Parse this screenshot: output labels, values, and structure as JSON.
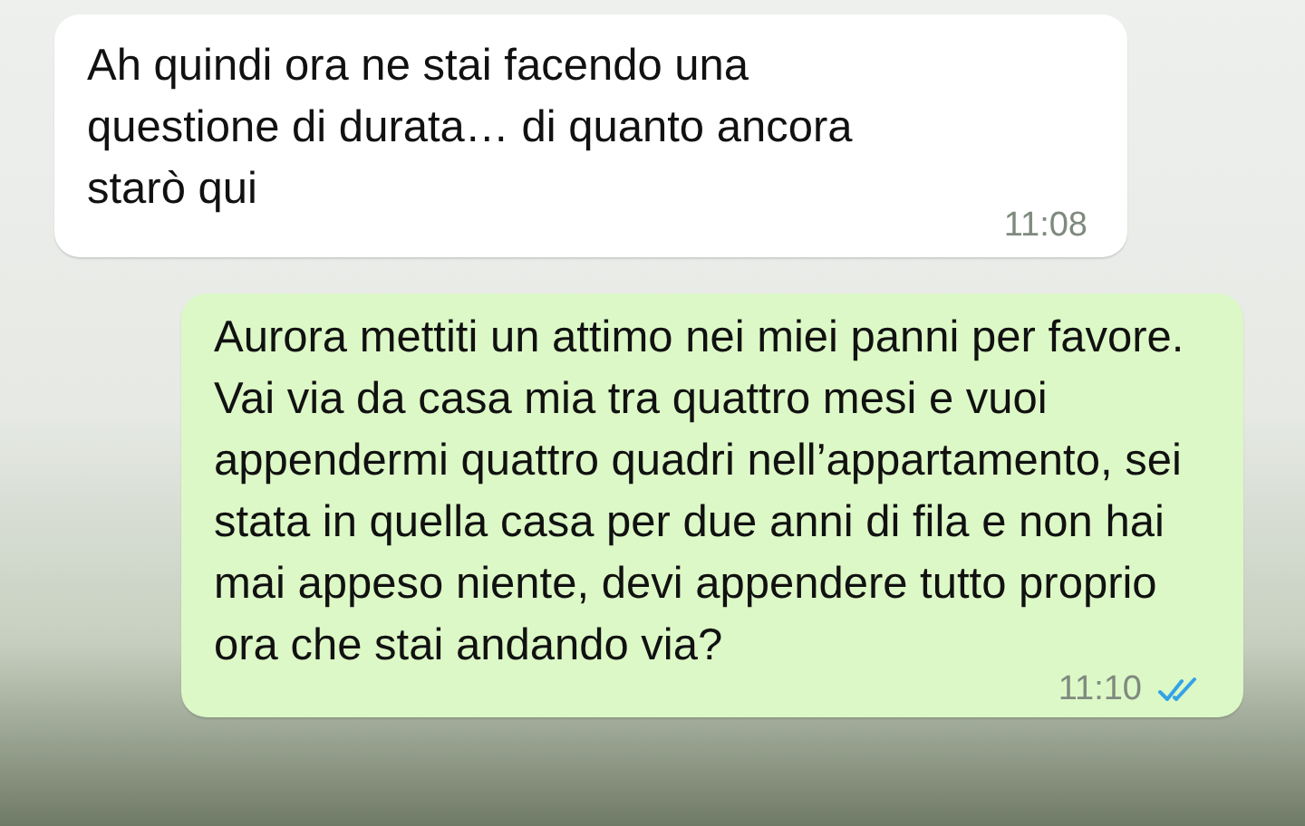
{
  "messages": [
    {
      "kind": "incoming",
      "text": "Ah quindi ora ne stai facendo una questione di durata… di quanto ancora starò qui",
      "time": "11:08"
    },
    {
      "kind": "outgoing",
      "text": "Aurora mettiti un attimo nei miei panni per favore. Vai via da casa mia tra quattro mesi e vuoi appendermi quattro quadri nell’appartamento, sei stata in quella casa per due anni di fila e non hai mai appeso niente, devi appendere tutto proprio ora che stai andando via?",
      "time": "11:10",
      "read": true
    }
  ]
}
